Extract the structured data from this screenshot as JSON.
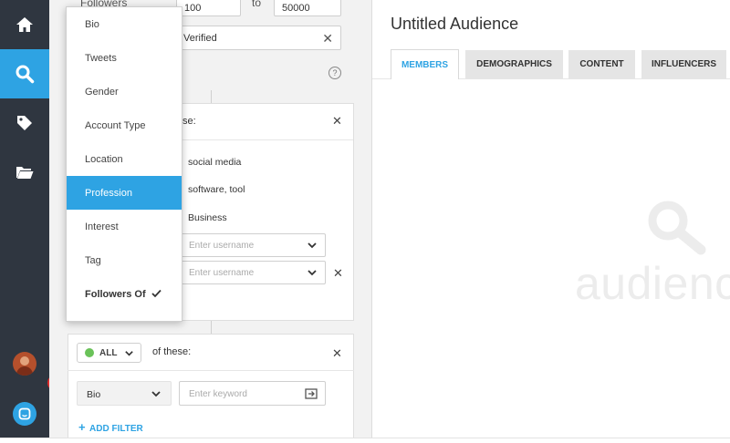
{
  "sidebar": {
    "nav": [
      {
        "icon": "home-icon"
      },
      {
        "icon": "search-icon",
        "active": true
      },
      {
        "icon": "tag-icon"
      },
      {
        "icon": "folder-icon"
      }
    ],
    "notification_count": "1",
    "colors": {
      "bg": "#2f3640",
      "active": "#2ea3e3",
      "badge": "#e02b2b"
    }
  },
  "filters": {
    "followers_label": "Followers",
    "followers_min": "100",
    "followers_to": "to",
    "followers_max": "50000",
    "verified_value": "Verified",
    "card1": {
      "header_suffix": "se:",
      "keywords": [
        "social media",
        "software, tool",
        "Business"
      ],
      "username_placeholder": "Enter username"
    },
    "card2": {
      "match_value": "ALL",
      "match_suffix": "of these:",
      "field_value": "Bio",
      "keyword_placeholder": "Enter keyword",
      "add_filter_label": "ADD FILTER"
    }
  },
  "dropdown": {
    "items": [
      "Bio",
      "Tweets",
      "Gender",
      "Account Type",
      "Location",
      "Profession",
      "Interest",
      "Tag",
      "Followers Of"
    ],
    "highlighted": "Profession",
    "selected": "Followers Of"
  },
  "main": {
    "title": "Untitled Audience",
    "tabs": [
      {
        "label": "MEMBERS",
        "active": true
      },
      {
        "label": "DEMOGRAPHICS"
      },
      {
        "label": "CONTENT"
      },
      {
        "label": "INFLUENCERS"
      }
    ],
    "watermark": "audienc"
  }
}
